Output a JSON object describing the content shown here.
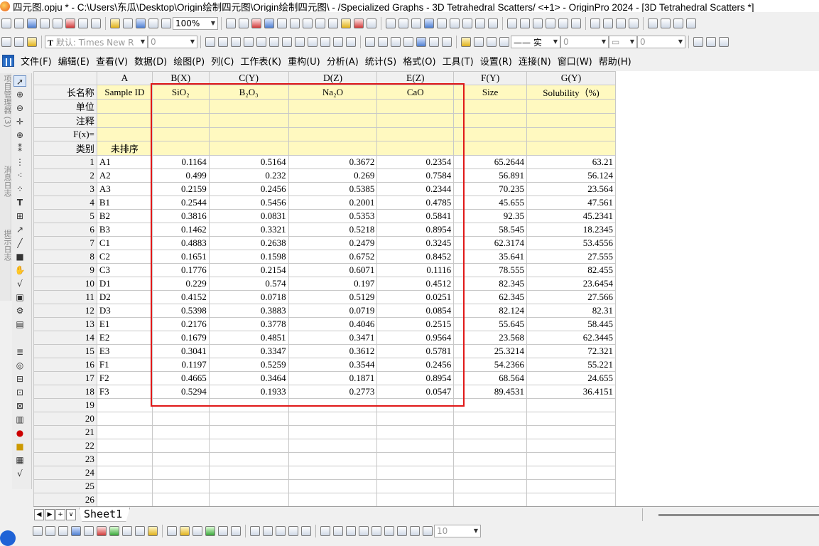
{
  "window": {
    "title": "四元图.opju * - C:\\Users\\东瓜\\Desktop\\Origin绘制四元图\\Origin绘制四元图\\ - /Specialized Graphs - 3D Tetrahedral Scatters/ <+1> - OriginPro 2024 - [3D Tetrahedral Scatters *]"
  },
  "toolbar1": {
    "zoom": "100%",
    "icons": [
      "new-project-icon",
      "new-workbook-icon",
      "new-graph-icon",
      "new-matrix-icon",
      "open-icon",
      "save-icon",
      "print-icon",
      "import-icon",
      "plot-icon",
      "stats-icon",
      "filter-icon"
    ]
  },
  "toolbar2": {
    "font_prefix": "默认:",
    "font_name": "Times New R",
    "font_size": "0",
    "line_style": "实",
    "line_width": "0",
    "border_width": "0"
  },
  "menu": {
    "items": [
      "文件(F)",
      "编辑(E)",
      "查看(V)",
      "数据(D)",
      "绘图(P)",
      "列(C)",
      "工作表(K)",
      "重构(U)",
      "分析(A)",
      "统计(S)",
      "格式(O)",
      "工具(T)",
      "设置(R)",
      "连接(N)",
      "窗口(W)",
      "帮助(H)"
    ]
  },
  "sidedock": {
    "panels": [
      "项目管理器 (3)",
      "消息日志",
      "提示日志"
    ]
  },
  "sheet": {
    "columns": [
      {
        "header": "A",
        "long_name": "Sample ID"
      },
      {
        "header": "B(X)",
        "long_name": "SiO₂"
      },
      {
        "header": "C(Y)",
        "long_name": "B₂O₃"
      },
      {
        "header": "D(Z)",
        "long_name": "Na₂O"
      },
      {
        "header": "E(Z)",
        "long_name": "CaO"
      },
      {
        "header": "F(Y)",
        "long_name": "Size"
      },
      {
        "header": "G(Y)",
        "long_name": "Solubility（%)"
      }
    ],
    "meta_rows": {
      "long_name_label": "长名称",
      "units_label": "单位",
      "comments_label": "注释",
      "fx_label": "F(x)=",
      "category_label": "类别",
      "category_value": "未排序"
    },
    "rows": [
      [
        "A1",
        "0.1164",
        "0.5164",
        "0.3672",
        "0.2354",
        "65.2644",
        "63.21"
      ],
      [
        "A2",
        "0.499",
        "0.232",
        "0.269",
        "0.7584",
        "56.891",
        "56.124"
      ],
      [
        "A3",
        "0.2159",
        "0.2456",
        "0.5385",
        "0.2344",
        "70.235",
        "23.564"
      ],
      [
        "B1",
        "0.2544",
        "0.5456",
        "0.2001",
        "0.4785",
        "45.655",
        "47.561"
      ],
      [
        "B2",
        "0.3816",
        "0.0831",
        "0.5353",
        "0.5841",
        "92.35",
        "45.2341"
      ],
      [
        "B3",
        "0.1462",
        "0.3321",
        "0.5218",
        "0.8954",
        "58.545",
        "18.2345"
      ],
      [
        "C1",
        "0.4883",
        "0.2638",
        "0.2479",
        "0.3245",
        "62.3174",
        "53.4556"
      ],
      [
        "C2",
        "0.1651",
        "0.1598",
        "0.6752",
        "0.8452",
        "35.641",
        "27.555"
      ],
      [
        "C3",
        "0.1776",
        "0.2154",
        "0.6071",
        "0.1116",
        "78.555",
        "82.455"
      ],
      [
        "D1",
        "0.229",
        "0.574",
        "0.197",
        "0.4512",
        "82.345",
        "23.6454"
      ],
      [
        "D2",
        "0.4152",
        "0.0718",
        "0.5129",
        "0.0251",
        "62.345",
        "27.566"
      ],
      [
        "D3",
        "0.5398",
        "0.3883",
        "0.0719",
        "0.0854",
        "82.124",
        "82.31"
      ],
      [
        "E1",
        "0.2176",
        "0.3778",
        "0.4046",
        "0.2515",
        "55.645",
        "58.445"
      ],
      [
        "E2",
        "0.1679",
        "0.4851",
        "0.3471",
        "0.9564",
        "23.568",
        "62.3445"
      ],
      [
        "E3",
        "0.3041",
        "0.3347",
        "0.3612",
        "0.5781",
        "25.3214",
        "72.321"
      ],
      [
        "F1",
        "0.1197",
        "0.5259",
        "0.3544",
        "0.2456",
        "54.2366",
        "55.221"
      ],
      [
        "F2",
        "0.4665",
        "0.3464",
        "0.1871",
        "0.8954",
        "68.564",
        "24.655"
      ],
      [
        "F3",
        "0.5294",
        "0.1933",
        "0.2773",
        "0.0547",
        "89.4531",
        "36.4151"
      ]
    ],
    "empty_row_numbers": [
      "19",
      "20",
      "21",
      "22",
      "23",
      "24",
      "25",
      "26"
    ],
    "highlight_color": "#e01818",
    "meta_color": "#fff9c0"
  },
  "tabs": {
    "sheet_tab": "Sheet1",
    "nav": [
      "◀",
      "▶",
      "+",
      "∨"
    ]
  },
  "bottom_toolbar": {
    "size_value": "10"
  }
}
